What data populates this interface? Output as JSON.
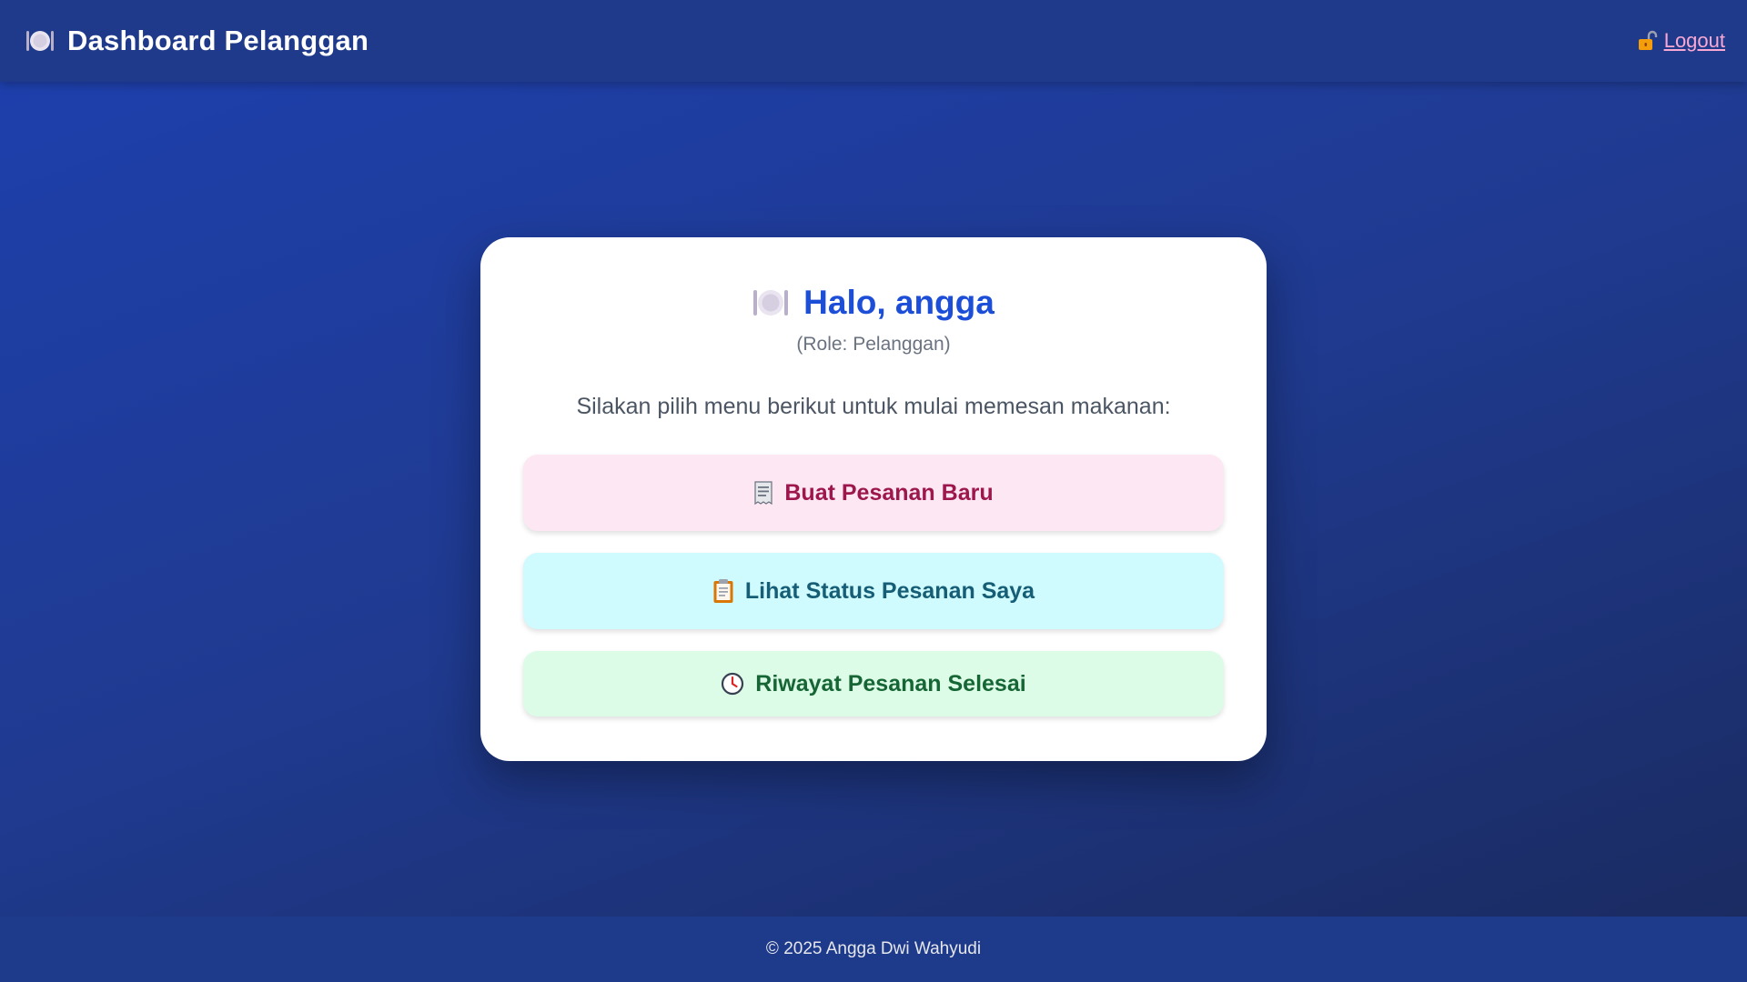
{
  "header": {
    "title": "Dashboard Pelanggan",
    "icon": "plate-icon",
    "logout_label": "Logout",
    "logout_icon": "unlocked-padlock-icon"
  },
  "card": {
    "greeting": "Halo, angga",
    "greeting_icon": "plate-icon",
    "role": "(Role: Pelanggan)",
    "intro": "Silakan pilih menu berikut untuk mulai memesan makanan:"
  },
  "menu": {
    "new_order": {
      "label": "Buat Pesanan Baru",
      "icon": "receipt-icon"
    },
    "order_status": {
      "label": "Lihat Status Pesanan Saya",
      "icon": "clipboard-icon"
    },
    "order_history": {
      "label": "Riwayat Pesanan Selesai",
      "icon": "clock-icon"
    }
  },
  "footer": {
    "text": "© 2025 Angga Dwi Wahyudi"
  },
  "colors": {
    "accent": "#1d4ed8",
    "header_bg": "#1f3a8a",
    "logout_link": "#f9a8d4",
    "new_order_bg": "#fce7f3",
    "new_order_text": "#9d174d",
    "status_bg": "#cffafe",
    "status_text": "#155e75",
    "history_bg": "#dcfce7",
    "history_text": "#166534"
  }
}
